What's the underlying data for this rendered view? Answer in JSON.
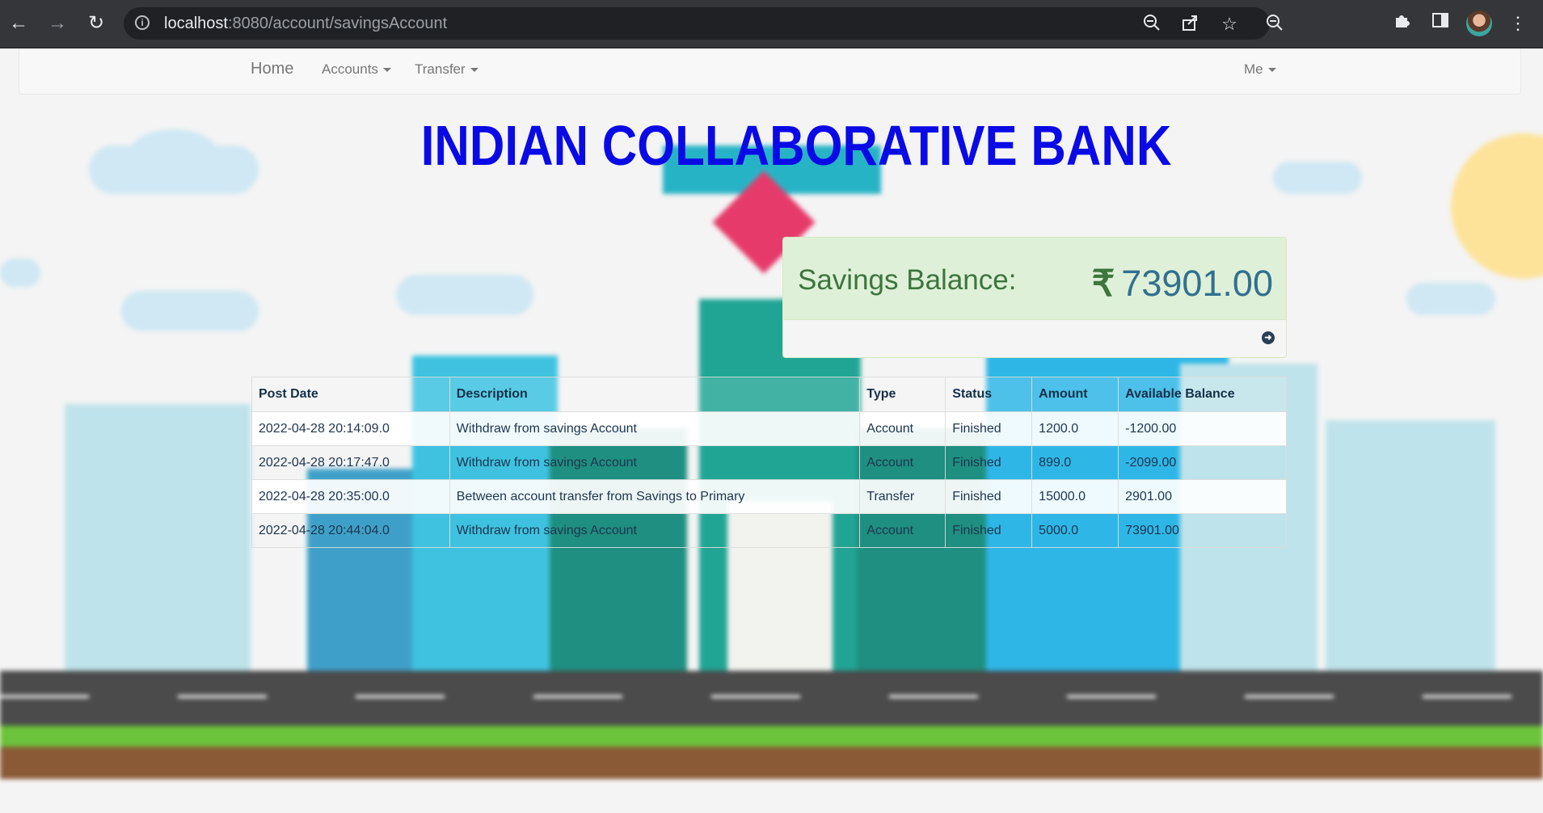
{
  "browser": {
    "url_host": "localhost",
    "url_path": ":8080/account/savingsAccount"
  },
  "navbar": {
    "brand": "Home",
    "accounts": "Accounts",
    "transfer": "Transfer",
    "me": "Me"
  },
  "page_title": "INDIAN COLLABORATIVE BANK",
  "balance": {
    "label": "Savings Balance:",
    "currency_symbol": "₹",
    "amount": "73901.00"
  },
  "table": {
    "headers": [
      "Post Date",
      "Description",
      "Type",
      "Status",
      "Amount",
      "Available Balance"
    ],
    "rows": [
      [
        "2022-04-28 20:14:09.0",
        "Withdraw from savings Account",
        "Account",
        "Finished",
        "1200.0",
        "-1200.00"
      ],
      [
        "2022-04-28 20:17:47.0",
        "Withdraw from savings Account",
        "Account",
        "Finished",
        "899.0",
        "-2099.00"
      ],
      [
        "2022-04-28 20:35:00.0",
        "Between account transfer from Savings to Primary",
        "Transfer",
        "Finished",
        "15000.0",
        "2901.00"
      ],
      [
        "2022-04-28 20:44:04.0",
        "Withdraw from savings Account",
        "Account",
        "Finished",
        "5000.0",
        "73901.00"
      ]
    ]
  },
  "icons": {
    "back": "arrow-left-icon",
    "forward": "arrow-right-icon",
    "reload": "reload-icon",
    "site_info": "info-icon",
    "zoom": "zoom-out-icon",
    "share": "share-icon",
    "bookmark": "star-icon",
    "extensions": "puzzle-icon",
    "sidepanel": "side-panel-icon",
    "menu": "kebab-menu-icon",
    "panel_footer": "circle-arrow-right-icon"
  },
  "colors": {
    "title": "#0a0ae6",
    "panel_heading_bg": "#dff0d8",
    "panel_label": "#3c763d",
    "panel_amount": "#31708f"
  }
}
